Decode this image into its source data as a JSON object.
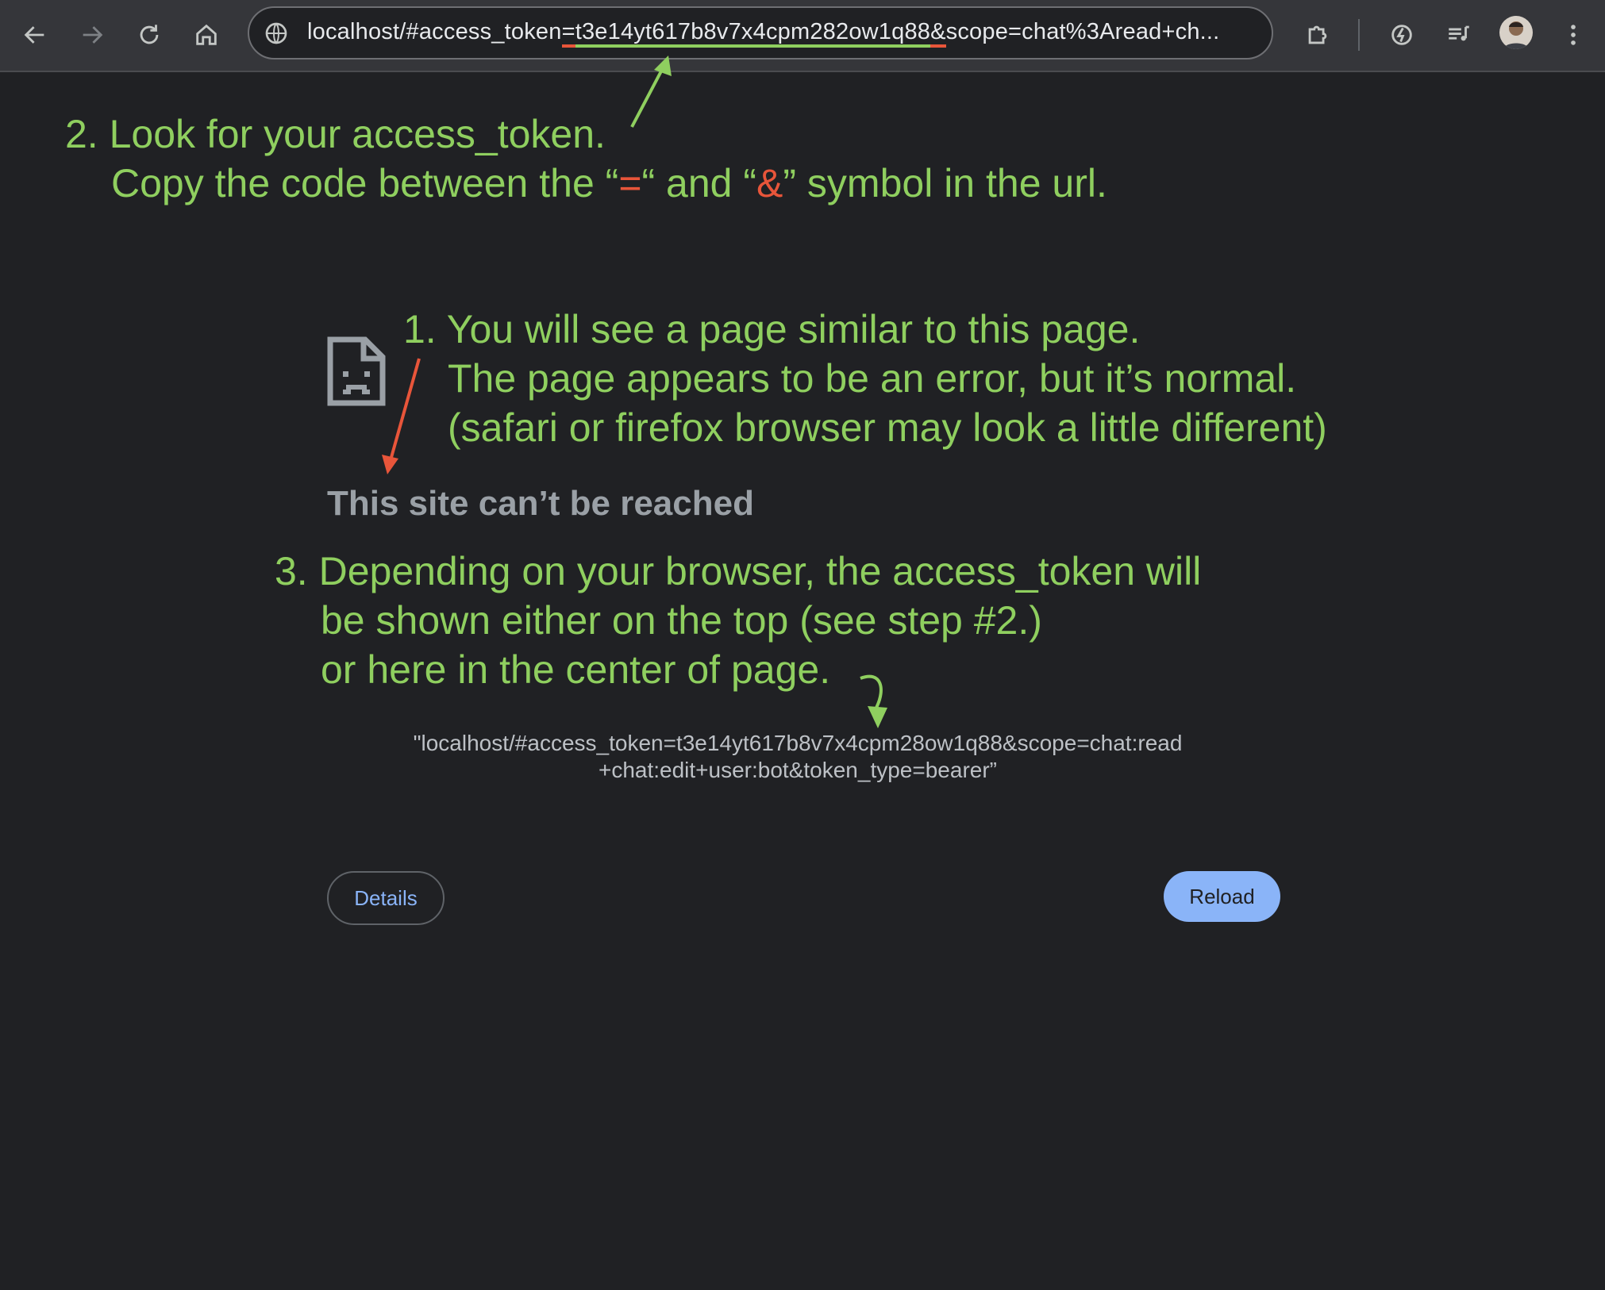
{
  "browser": {
    "url_prefix": "localhost/#access_token",
    "url_eq": "=",
    "url_token": "t3e14yt617b8v7x4cpm282ow1q88",
    "url_amp": "&",
    "url_suffix": "scope=chat%3Aread+ch...",
    "icons": [
      "back-icon",
      "forward-icon",
      "reload-icon",
      "home-icon",
      "site-info-icon",
      "extensions-icon",
      "performance-icon",
      "media-queue-icon",
      "profile-avatar",
      "more-menu-icon"
    ]
  },
  "annotations": {
    "step2_line1": "2. Look for your access_token.",
    "step2_line2_a": "Copy the code between the “",
    "step2_eq": "=",
    "step2_line2_b": "“ and “",
    "step2_amp": "&",
    "step2_line2_c": "” symbol in the url.",
    "step1_line1": "1. You will see a page similar to this page.",
    "step1_line2": "The page appears to be an error, but it’s normal.",
    "step1_line3": "(safari or firefox browser may look a little different)",
    "step3_line1": "3. Depending on your browser, the access_token will",
    "step3_line2": "be shown either on the top (see step #2.)",
    "step3_line3": "or here in the center of page.",
    "colors": {
      "green": "#8fcf5f",
      "red": "#e8553a"
    }
  },
  "page": {
    "heading": "This site can’t be reached",
    "token_line1": "\"localhost/#access_token=t3e14yt617b8v7x4cpm28ow1q88&scope=chat:read",
    "token_line2": "+chat:edit+user:bot&token_type=bearer”",
    "details_label": "Details",
    "reload_label": "Reload",
    "accent": "#8ab4f8"
  }
}
